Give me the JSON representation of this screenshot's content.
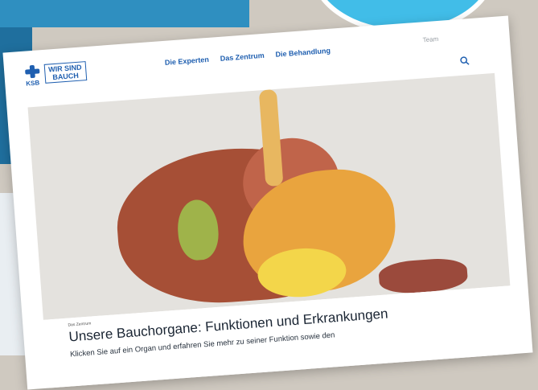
{
  "logo": {
    "brand": "KSB",
    "line1": "WIR SIND",
    "line2": "BAUCH"
  },
  "nav": {
    "items": [
      "Die Experten",
      "Das Zentrum",
      "Die Behandlung"
    ],
    "team": "Team"
  },
  "hero": {
    "kicker": "Das Zentrum",
    "title": "Unsere Bauchorgane: Funktionen und Erkrankungen",
    "description": "Klicken Sie auf ein Organ und erfahren Sie mehr zu seiner Funktion sowie den"
  }
}
